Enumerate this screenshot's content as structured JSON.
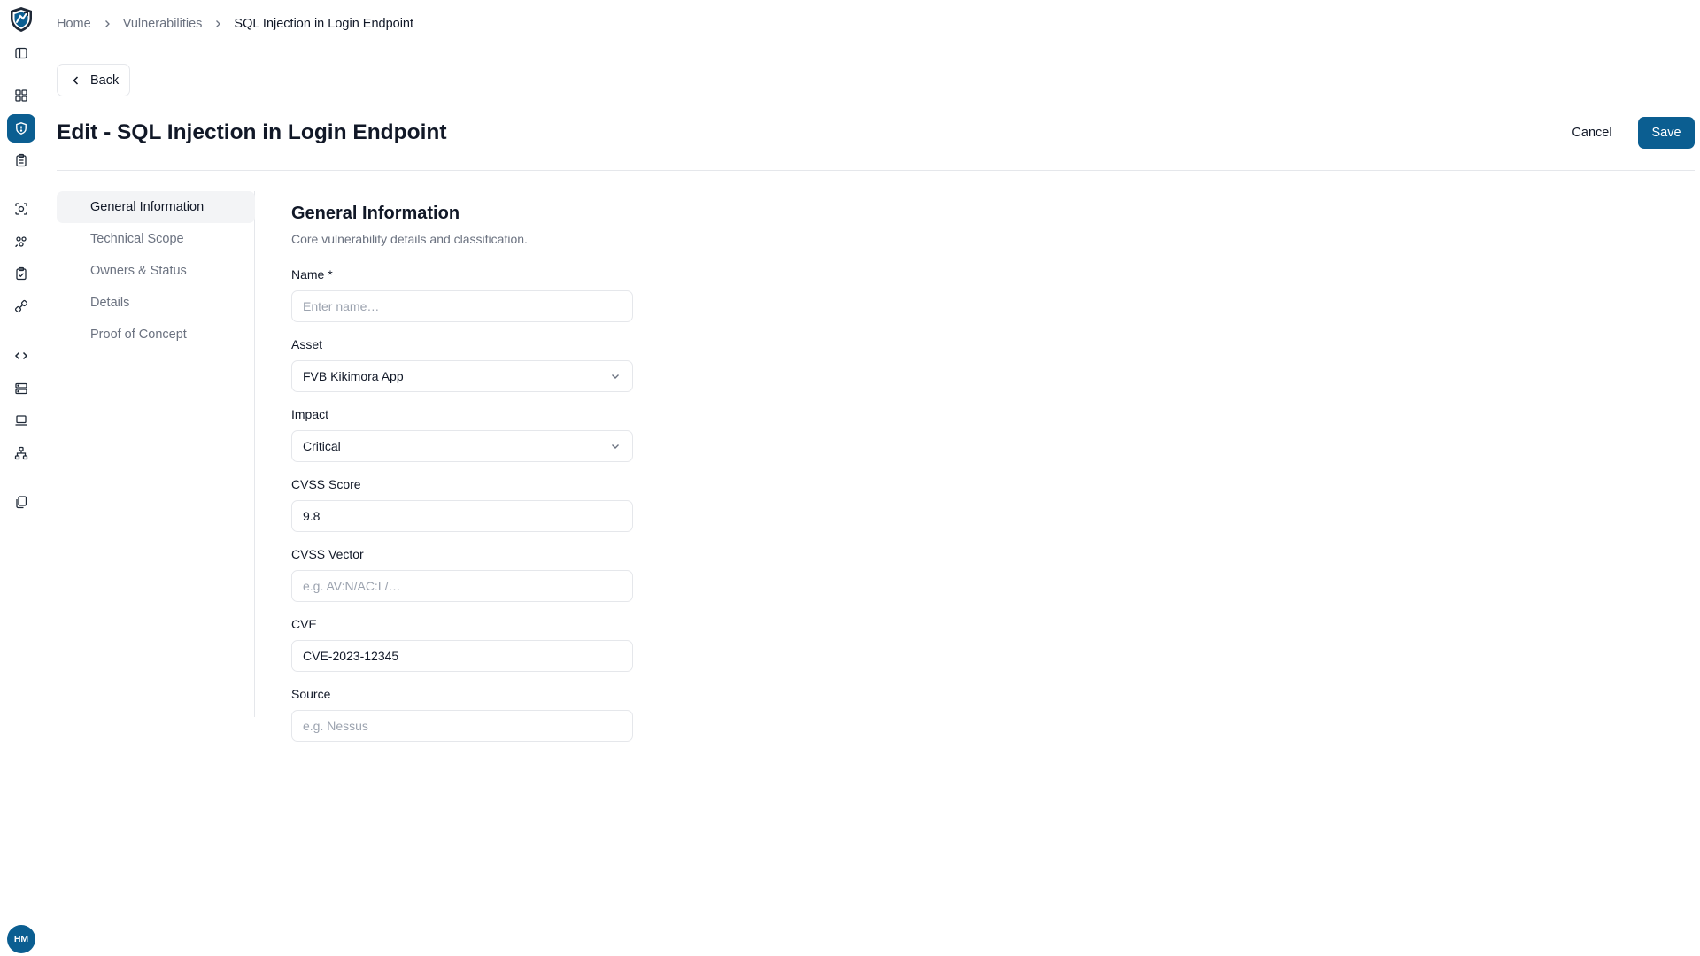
{
  "sidebar": {
    "icons": [
      "shield-logo-icon",
      "panel-toggle-icon",
      "dashboard-icon",
      "vulnerabilities-icon",
      "clipboard-icon",
      "scan-icon",
      "teams-icon",
      "checklist-icon",
      "integrations-icon",
      "code-icon",
      "server-icon",
      "laptop-icon",
      "network-icon",
      "documents-icon"
    ],
    "avatar_initials": "HM"
  },
  "breadcrumb": {
    "home": "Home",
    "section": "Vulnerabilities",
    "current": "SQL Injection in Login Endpoint"
  },
  "back_label": "Back",
  "page_title": "Edit - SQL Injection in Login Endpoint",
  "actions": {
    "cancel": "Cancel",
    "save": "Save"
  },
  "section_nav": [
    "General Information",
    "Technical Scope",
    "Owners & Status",
    "Details",
    "Proof of Concept"
  ],
  "form": {
    "title": "General Information",
    "description": "Core vulnerability details and classification.",
    "fields": {
      "name": {
        "label": "Name *",
        "value": "",
        "placeholder": "Enter name…"
      },
      "asset": {
        "label": "Asset",
        "value": "FVB Kikimora App"
      },
      "impact": {
        "label": "Impact",
        "value": "Critical"
      },
      "cvss_score": {
        "label": "CVSS Score",
        "value": "9.8"
      },
      "cvss_vector": {
        "label": "CVSS Vector",
        "value": "",
        "placeholder": "e.g. AV:N/AC:L/…"
      },
      "cve": {
        "label": "CVE",
        "value": "CVE-2023-12345"
      },
      "source": {
        "label": "Source",
        "value": "",
        "placeholder": "e.g. Nessus"
      }
    }
  },
  "colors": {
    "primary": "#0b5e91",
    "border": "#e5e7eb",
    "muted_text": "#6b7280"
  }
}
